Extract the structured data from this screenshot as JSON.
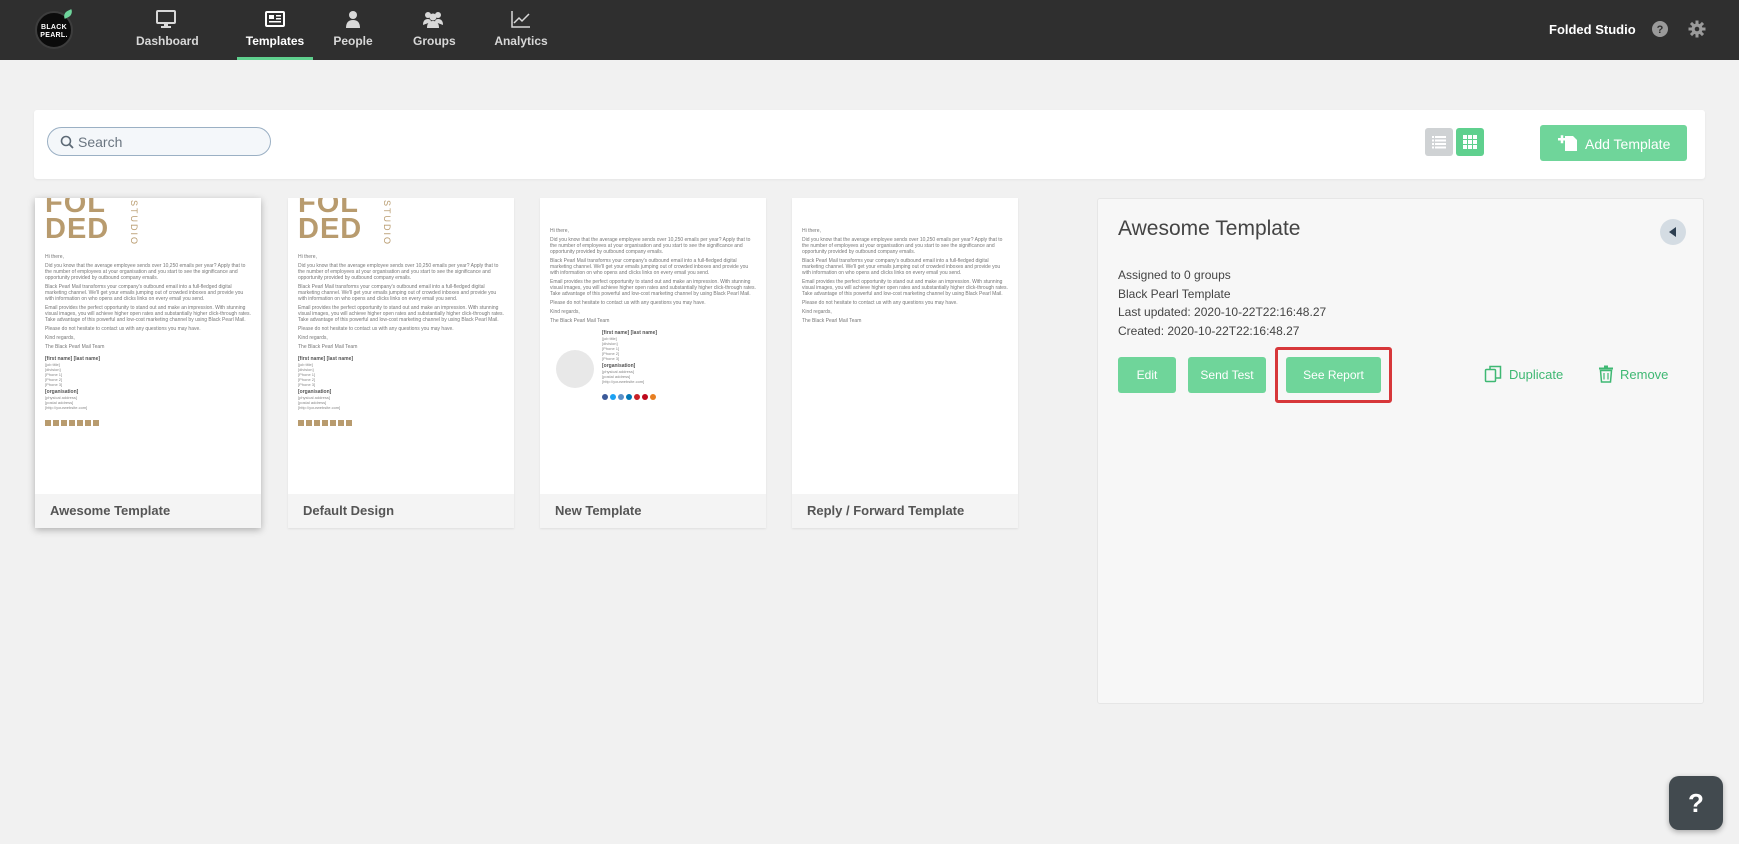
{
  "brand": {
    "logo_text_1": "BLACK",
    "logo_text_2": "PEARL."
  },
  "nav": {
    "items": [
      {
        "label": "Dashboard",
        "icon": "monitor-icon",
        "active": false
      },
      {
        "label": "Templates",
        "icon": "newspaper-icon",
        "active": true
      },
      {
        "label": "People",
        "icon": "person-icon",
        "active": false
      },
      {
        "label": "Groups",
        "icon": "group-icon",
        "active": false
      },
      {
        "label": "Analytics",
        "icon": "line-chart-icon",
        "active": false
      }
    ],
    "account_name": "Folded Studio",
    "help_icon": "question-circle-icon",
    "settings_icon": "gear-icon"
  },
  "toolbar": {
    "search_placeholder": "Search",
    "search_value": "",
    "list_view_icon": "list-icon",
    "grid_view_icon": "grid-icon",
    "add_label": "Add Template"
  },
  "thumbnail": {
    "logo_top": "FOL",
    "logo_bottom": "DED",
    "logo_side": "STUDIO",
    "greeting": "Hi there,",
    "para1": "Did you know that the average employee sends over 10,250 emails per year? Apply that to the number of employees at your organisation and you start to see the significance and opportunity provided by outbound company emails.",
    "para2": "Black Pearl Mail transforms your company's outbound email into a full-fledged digital marketing channel. We'll get your emails jumping out of crowded inboxes and provide you with information on who opens and clicks links on every email you send.",
    "para3": "Email provides the perfect opportunity to stand out and make an impression. With stunning visual images, you will achieve higher open rates and substantially higher click-through rates. Take advantage of this powerful and low-cost marketing channel by using Black Pearl Mail.",
    "para4": "Please do not hesitate to contact us with any questions you may have.",
    "regards": "Kind regards,",
    "team": "The Black Pearl Mail Team",
    "sig_name": "[first name] [last name]",
    "sig_job": "[job title]",
    "sig_division": "[division]",
    "sig_phone1": "[Phone 1]",
    "sig_phone2": "[Phone 2]",
    "sig_phone3": "[Phone 3]",
    "sig_org": "[organisation]",
    "sig_address": "[physical address]",
    "sig_postal": "[postal address]",
    "sig_web": "[http://yourwebsite.com]"
  },
  "templates": [
    {
      "name": "Awesome Template",
      "selected": true
    },
    {
      "name": "Default Design",
      "selected": false
    },
    {
      "name": "New Template",
      "selected": false
    },
    {
      "name": "Reply / Forward Template",
      "selected": false
    }
  ],
  "detail": {
    "title": "Awesome Template",
    "collapse_icon": "caret-left-icon",
    "assigned": "Assigned to 0 groups",
    "base": "Black Pearl Template",
    "updated": "Last updated: 2020-10-22T22:16:48.27",
    "created": "Created: 2020-10-22T22:16:48.27",
    "edit_label": "Edit",
    "send_test_label": "Send Test",
    "see_report_label": "See Report",
    "duplicate_label": "Duplicate",
    "remove_label": "Remove",
    "highlight_color": "#d7373a"
  },
  "help_fab": "?"
}
